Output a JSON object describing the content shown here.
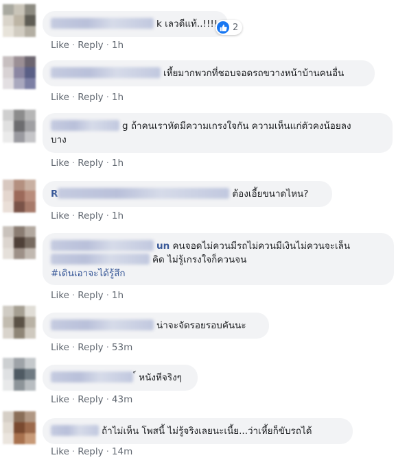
{
  "comments": [
    {
      "author_visible": "",
      "text": "k เลวดีแท้..!!!!",
      "time": "1h",
      "reactions": {
        "icon": "like-icon",
        "count": "2"
      }
    },
    {
      "author_visible": "",
      "text": "เหี้ยมากพวกที่ชอบจอดรถขวางหน้าบ้านคนอื่น",
      "time": "1h"
    },
    {
      "author_visible": "",
      "line1": "g ถ้าคนเราหัดมีความเกรงใจกัน ความเห็นแก่ตัวคงน้อยลง",
      "line2": "บาง",
      "time": "1h"
    },
    {
      "author_visible": "R",
      "text": "ต้องเอี้ยขนาดไหน?",
      "time": "1h"
    },
    {
      "author_visible": "un",
      "line1": "คนจอดไม่ควนมีรถไม่ควนมีเงินไม่ควนจะเล็น",
      "line2": "คิด ไม่รู้เกรงใจก็ควนจน",
      "hashtag": "#เดินเอาจะได้รู้สึก",
      "time": "1h"
    },
    {
      "author_visible": "",
      "text": "น่าจะจัดรอยรอบคันนะ",
      "time": "53m"
    },
    {
      "author_visible": "",
      "text": "์ หนังหีจริงๆ",
      "time": "43m"
    },
    {
      "author_visible": "",
      "text": "ถ้าไม่เห็น โพสนี้ ไม่รู้จริงเลยนะเนี้ย...ว่าเหี้ยก็ขับรถได้",
      "time": "14m"
    }
  ],
  "labels": {
    "like": "Like",
    "reply": "Reply",
    "dot": "·"
  },
  "colors": {
    "bubble_bg": "#f2f3f5",
    "link_blue": "#385898",
    "meta_gray": "#606770",
    "like_blue": "#1877f2"
  }
}
